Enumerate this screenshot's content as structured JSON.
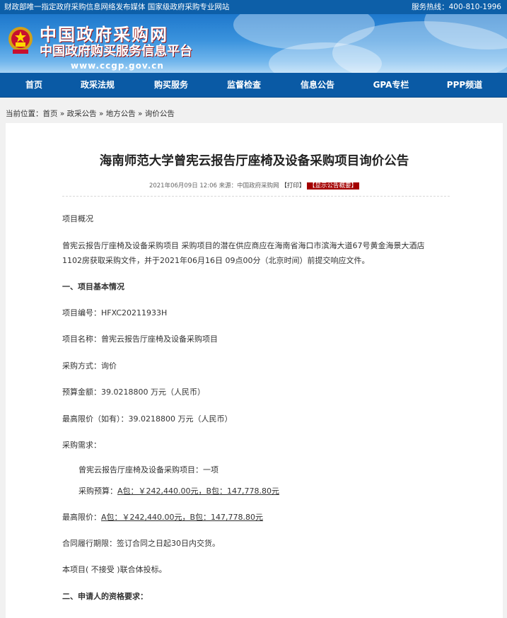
{
  "topbar": {
    "slogan": "财政部唯一指定政府采购信息网络发布媒体 国家级政府采购专业网站",
    "hotline": "服务热线：400-810-1996"
  },
  "header": {
    "site_name": "中国政府采购网",
    "site_subtitle": "中国政府购买服务信息平台",
    "site_url": "www.ccgp.gov.cn"
  },
  "nav": {
    "items": [
      "首页",
      "政采法规",
      "购买服务",
      "监督检查",
      "信息公告",
      "GPA专栏",
      "PPP频道"
    ]
  },
  "breadcrumb": {
    "prefix": "当前位置：",
    "items": [
      "首页",
      "政采公告",
      "地方公告",
      "询价公告"
    ],
    "sep": " » "
  },
  "article": {
    "title": "海南师范大学曾宪云报告厅座椅及设备采购项目询价公告",
    "date": "2021年06月09日 12:06",
    "source": "来源：中国政府采购网",
    "print_label": "【打印】",
    "summary_tag": "【显示公告概要】",
    "overview_heading": "项目概况",
    "overview_text": "曾宪云报告厅座椅及设备采购项目 采购项目的潜在供应商应在海南省海口市滨海大道67号黄金海景大酒店1102房获取采购文件，并于2021年06月16日 09点00分（北京时间）前提交响应文件。",
    "section1_heading": "一、项目基本情况",
    "project_no": "项目编号：HFXC20211933H",
    "project_name": "项目名称：曾宪云报告厅座椅及设备采购项目",
    "method": "采购方式：询价",
    "budget": "预算金额：39.0218800 万元（人民币）",
    "max_price": "最高限价（如有）：39.0218800 万元（人民币）",
    "demand_label": "采购需求：",
    "demand_item": "曾宪云报告厅座椅及设备采购项目：一项",
    "demand_budget_prefix": "采购预算：",
    "demand_budget_value": "A包：￥242,440.00元，B包：147,778.80元",
    "limit_prefix": "最高限价：",
    "limit_value": "A包：￥242,440.00元，B包：147,778.80元",
    "contract_period": "合同履行期限：签订合同之日起30日内交货。",
    "consortium": "本项目( 不接受 )联合体投标。",
    "section2_heading": "二、申请人的资格要求："
  }
}
